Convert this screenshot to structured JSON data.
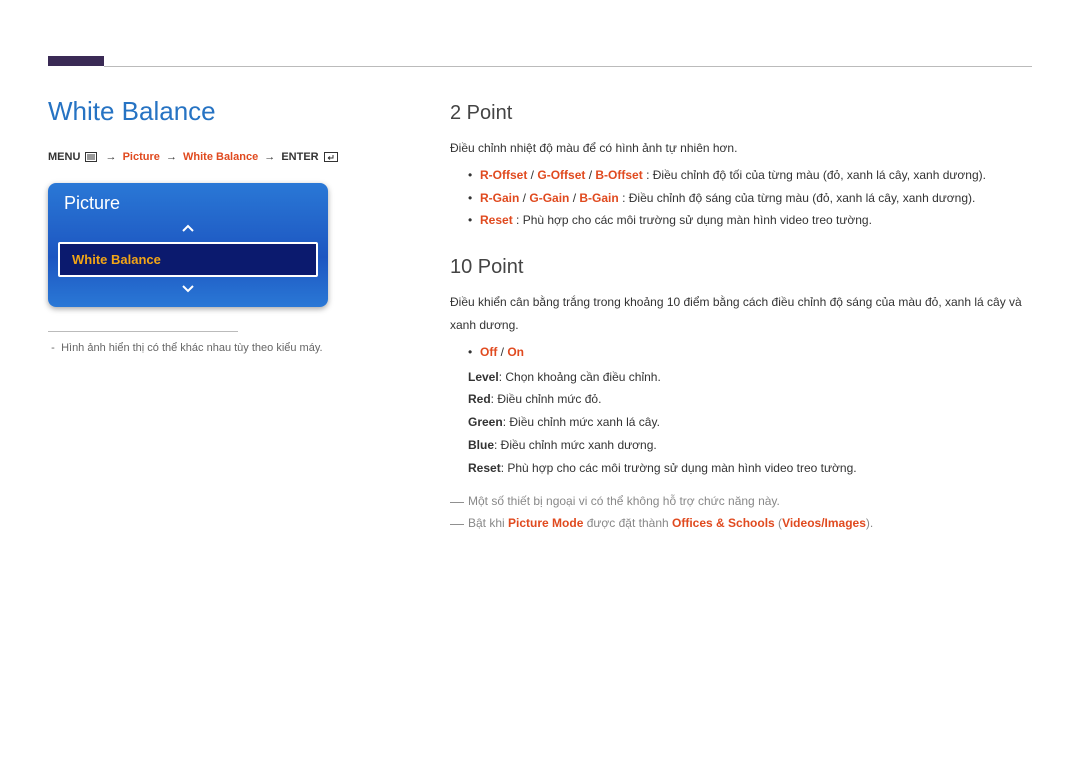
{
  "left": {
    "title": "White Balance",
    "menu_path": {
      "menu_label": "MENU",
      "picture": "Picture",
      "white_balance": "White Balance",
      "enter": "ENTER"
    },
    "osd": {
      "header": "Picture",
      "selected_item": "White Balance"
    },
    "caption": "Hình ảnh hiển thị có thể khác nhau tùy theo kiểu máy."
  },
  "two_point": {
    "heading": "2 Point",
    "intro": "Điều chỉnh nhiệt độ màu để có hình ảnh tự nhiên hơn.",
    "bullets": {
      "offset": {
        "r": "R-Offset",
        "g": "G-Offset",
        "b": "B-Offset",
        "desc": ": Điều chỉnh độ tối của từng màu (đỏ, xanh lá cây, xanh dương)."
      },
      "gain": {
        "r": "R-Gain",
        "g": "G-Gain",
        "b": "B-Gain",
        "desc": ": Điều chỉnh độ sáng của từng màu (đỏ, xanh lá cây, xanh dương)."
      },
      "reset": {
        "label": "Reset",
        "desc": ": Phù hợp cho các môi trường sử dụng màn hình video treo tường."
      }
    }
  },
  "ten_point": {
    "heading": "10 Point",
    "intro": "Điều khiển cân bằng trắng trong khoảng 10 điểm bằng cách điều chỉnh độ sáng của màu đỏ, xanh lá cây và xanh dương.",
    "toggle": {
      "off": "Off",
      "on": "On"
    },
    "lines": {
      "level": {
        "label": "Level",
        "desc": ": Chọn khoảng cần điều chỉnh."
      },
      "red": {
        "label": "Red",
        "desc": ": Điều chỉnh mức đỏ."
      },
      "green": {
        "label": "Green",
        "desc": ": Điều chỉnh mức xanh lá cây."
      },
      "blue": {
        "label": "Blue",
        "desc": ": Điều chỉnh mức xanh dương."
      },
      "reset": {
        "label": "Reset",
        "desc": ": Phù hợp cho các môi trường sử dụng màn hình video treo tường."
      }
    },
    "notes": {
      "n1": "Một số thiết bị ngoại vi có thể không hỗ trợ chức năng này.",
      "n2": {
        "pre": "Bật khi ",
        "pm": "Picture Mode",
        "mid": " được đặt thành ",
        "os": "Offices & Schools",
        "paren_open": " (",
        "vi": "Videos/Images",
        "paren_close": ")."
      }
    }
  }
}
